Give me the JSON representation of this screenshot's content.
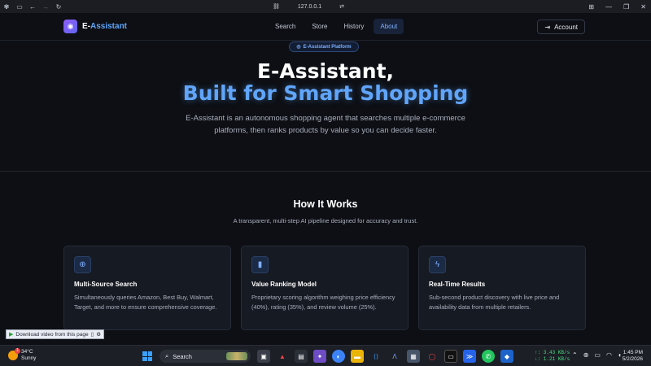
{
  "browser": {
    "address": "127.0.0.1"
  },
  "nav": {
    "brand": "E-",
    "brand_accent": "Assistant",
    "links": [
      "Search",
      "Store",
      "History",
      "About"
    ],
    "active": "About",
    "account": "Account"
  },
  "hero": {
    "badge": "E-Assistant Platform",
    "title_line1": "E-Assistant,",
    "title_line2": "Built for Smart Shopping",
    "lead": "E-Assistant is an autonomous shopping agent that searches multiple e-commerce platforms, then ranks products by value so you can decide faster."
  },
  "how": {
    "title": "How It Works",
    "subtitle": "A transparent, multi-step AI pipeline designed for accuracy and trust.",
    "cards": [
      {
        "icon": "globe-icon",
        "title": "Multi-Source Search",
        "desc": "Simultaneously queries Amazon, Best Buy, Walmart, Target, and more to ensure comprehensive coverage."
      },
      {
        "icon": "bar-chart-icon",
        "title": "Value Ranking Model",
        "desc": "Proprietary scoring algorithm weighing price efficiency (40%), rating (35%), and review volume (25%)."
      },
      {
        "icon": "lightning-icon",
        "title": "Real-Time Results",
        "desc": "Sub-second product discovery with live price and availability data from multiple retailers."
      }
    ]
  },
  "download_bar": {
    "label": "Download video from this page"
  },
  "taskbar": {
    "weather_temp": "34°C",
    "weather_desc": "Sunny",
    "weather_badge": "1",
    "search": "Search",
    "net_up": "↑: 3.43 KB/s",
    "net_down": "↓: 1.21 KB/s",
    "time": "1:45 PM",
    "date": "5/2/2026"
  },
  "colors": {
    "accent": "#60a5fa",
    "background": "#0d0f14",
    "card": "#161a22"
  }
}
